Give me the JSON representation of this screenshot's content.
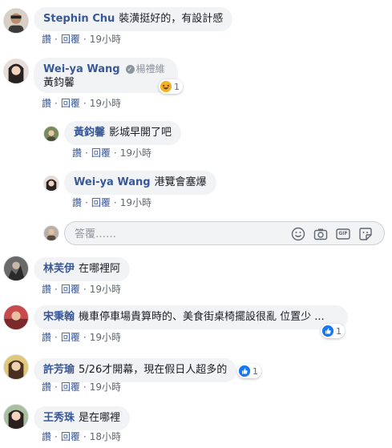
{
  "actions": {
    "like": "讚",
    "reply": "回覆",
    "dot": "·"
  },
  "colors": {
    "author": "#385898",
    "bubble": "#f2f3f5",
    "like_blue": "#1877f2"
  },
  "comments": [
    {
      "author": "Stephin Chu",
      "text": "裝潢挺好的，有設計感",
      "time": "19小時"
    },
    {
      "author": "Wei-ya Wang",
      "badge": "楊禮維",
      "text": "黃鈞馨",
      "time": "19小時",
      "reaction": {
        "icon": "haha-icon",
        "count": "1"
      }
    },
    {
      "author": "黃鈞馨",
      "text": "影城早開了吧",
      "time": "19小時"
    },
    {
      "author": "Wei-ya Wang",
      "text": "港覽會塞爆",
      "time": "19小時"
    },
    {
      "author": "林芙伊",
      "text": "在哪裡阿",
      "time": "19小時"
    },
    {
      "author": "宋秉翰",
      "text": "機車停車場貴算時的、美食街桌椅擺設很亂 位置少 ...",
      "time": "19小時",
      "reaction": {
        "icon": "like-icon",
        "count": "1"
      }
    },
    {
      "author": "許芳瑜",
      "text": "5/26才開幕，現在假日人超多的",
      "time": "19小時",
      "reaction": {
        "icon": "like-icon",
        "count": "1"
      }
    },
    {
      "author": "王秀珠",
      "text": "是在哪裡",
      "time": "18小時"
    }
  ],
  "composer": {
    "placeholder": "答覆……",
    "icons": [
      "emoji-icon",
      "camera-icon",
      "gif-icon",
      "sticker-icon"
    ],
    "gif_label": "GIF"
  }
}
